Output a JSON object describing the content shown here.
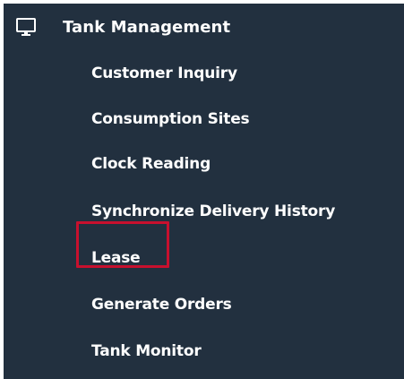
{
  "menu": {
    "header": {
      "icon": "monitor-icon",
      "label": "Tank Management"
    },
    "items": [
      {
        "label": "Customer Inquiry"
      },
      {
        "label": "Consumption Sites"
      },
      {
        "label": "Clock Reading"
      },
      {
        "label": "Synchronize Delivery History"
      },
      {
        "label": "Lease",
        "highlighted": true
      },
      {
        "label": "Generate Orders"
      },
      {
        "label": "Tank Monitor"
      }
    ]
  },
  "colors": {
    "sidebar_background": "#22303f",
    "text": "#ffffff",
    "highlight_border": "#c8102e"
  }
}
